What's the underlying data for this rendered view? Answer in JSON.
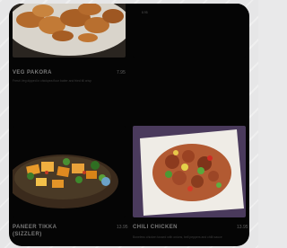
{
  "cards": [
    {
      "name": "VEG PAKORA",
      "price": "7.95",
      "description": "Fresh Veg dipped in chickpea flour batter and fried till crisp"
    },
    {
      "name": "",
      "price": "",
      "description": "8.95"
    },
    {
      "name": "PANEER TIKKA",
      "name_line2": "(SIZZLER)",
      "price": "13.95",
      "description": ""
    },
    {
      "name": "CHILI CHICKEN",
      "price": "13.95",
      "description": "Boneless chicken tossed with onions, bell peppers and chilli sauce"
    }
  ]
}
